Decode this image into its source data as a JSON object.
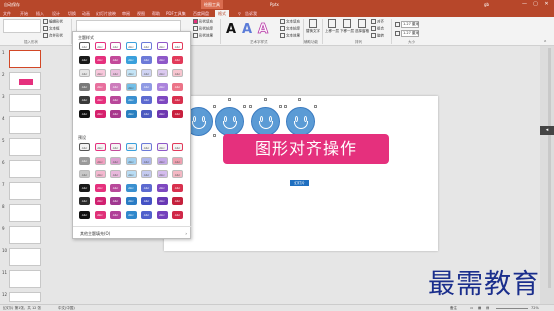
{
  "titlebar": {
    "left_label": "自动保存",
    "context_tab": "绘图工具",
    "doc_title": "Pptx",
    "user": "gb",
    "minimize": "—",
    "maximize": "▢",
    "close": "✕"
  },
  "tabs": [
    "文件",
    "开始",
    "插入",
    "设计",
    "切换",
    "动画",
    "幻灯片放映",
    "审阅",
    "视图",
    "帮助",
    "PDF工具集",
    "百度网盘",
    "格式"
  ],
  "active_tab": "格式",
  "extra_tab": "告诉我",
  "ribbon": {
    "insert_shapes": {
      "label": "插入形状",
      "edit_shape": "编辑形状",
      "text_box": "文本框",
      "merge_shapes": "合并形状"
    },
    "shape_styles": {
      "fill": "形状填充",
      "outline": "形状轮廓",
      "effects": "形状效果"
    },
    "wordart": {
      "label": "艺术字样式",
      "fill": "文本填充",
      "outline": "文本轮廓",
      "effects": "文本效果",
      "samples": [
        "A",
        "A",
        "A"
      ]
    },
    "accessibility": {
      "alt_text": "替换文字",
      "label": "辅助功能"
    },
    "arrange": {
      "label": "排列",
      "bring_forward": "上移一层",
      "send_backward": "下移一层",
      "selection_pane": "选择窗格",
      "align": "对齐",
      "group": "组合",
      "rotate": "旋转"
    },
    "size": {
      "label": "大小",
      "height": "1.27 厘米",
      "width": "1.27 厘米"
    }
  },
  "gallery": {
    "theme_styles_label": "主题样式",
    "presets_label": "预设",
    "other_fills": "其他主题填充(O)",
    "swatch_text": "Abc",
    "theme_rows": [
      [
        "#ffffff",
        "#ffffff",
        "#ffffff",
        "#ffffff",
        "#ffffff",
        "#ffffff",
        "#ffffff"
      ],
      [
        "#1a1a1a",
        "#e5307d",
        "#c34a9a",
        "#3aa0dc",
        "#6c7ad8",
        "#8e58c8",
        "#e23a5a"
      ],
      [
        "#e6e6e6",
        "#f8c8dc",
        "#eac0de",
        "#c4e4f6",
        "#d0d4f4",
        "#dccaf0",
        "#f8c6d0"
      ],
      [
        "#7a7a7a",
        "#e8709e",
        "#cd7cbc",
        "#72bfe8",
        "#8f9ae4",
        "#ab84dc",
        "#ec7488"
      ],
      [
        "#3a3a3a",
        "#e5307d",
        "#b8489a",
        "#3a90d0",
        "#5c6ad0",
        "#7e48c0",
        "#d8304e"
      ],
      [
        "#111111",
        "#d6206c",
        "#a8388c",
        "#2a80c0",
        "#4c5ac0",
        "#6e38b0",
        "#c8203e"
      ]
    ],
    "preset_rows": [
      [
        "#f4f4f4",
        "#f4f4f4",
        "#f4f4f4",
        "#f4f4f4",
        "#f4f4f4",
        "#f4f4f4",
        "#f4f4f4"
      ],
      [
        "#9a9a9a",
        "#f0a0c0",
        "#dca0d0",
        "#a0d0f0",
        "#b0b8ec",
        "#c4a8e8",
        "#f0a0b0"
      ],
      [
        "#c8c8c8",
        "#f4b8d0",
        "#e8b8dc",
        "#b8dcf4",
        "#c4caf0",
        "#d4bcee",
        "#f4b8c4"
      ],
      [
        "#1a1a1a",
        "#e5307d",
        "#b8489a",
        "#3a90d0",
        "#5c6ad0",
        "#7e48c0",
        "#d8304e"
      ],
      [
        "#2a2a2a",
        "#d02070",
        "#a03890",
        "#2a7cc4",
        "#4452c4",
        "#6838b4",
        "#c4203c"
      ],
      [
        "#111111",
        "#e03078",
        "#b04098",
        "#3088cc",
        "#5060cc",
        "#7440bc",
        "#d02848"
      ]
    ]
  },
  "slide": {
    "banner_text": "图形对齐操作",
    "tag_text": "幻灯片",
    "face_count": 4,
    "colors": {
      "face": "#5b9bd5",
      "banner": "#e5307d"
    }
  },
  "thumbs": {
    "numbers": [
      "1",
      "2",
      "3",
      "4",
      "5",
      "6",
      "7",
      "8",
      "9",
      "10",
      "11",
      "12"
    ],
    "selected": "1"
  },
  "statusbar": {
    "slide_info": "幻灯片 第1张，共 12 张",
    "language": "中文(中国)",
    "notes": "备注",
    "zoom": "72%"
  },
  "watermark": "最需教育",
  "colors": {
    "accent": "#b7472a"
  }
}
